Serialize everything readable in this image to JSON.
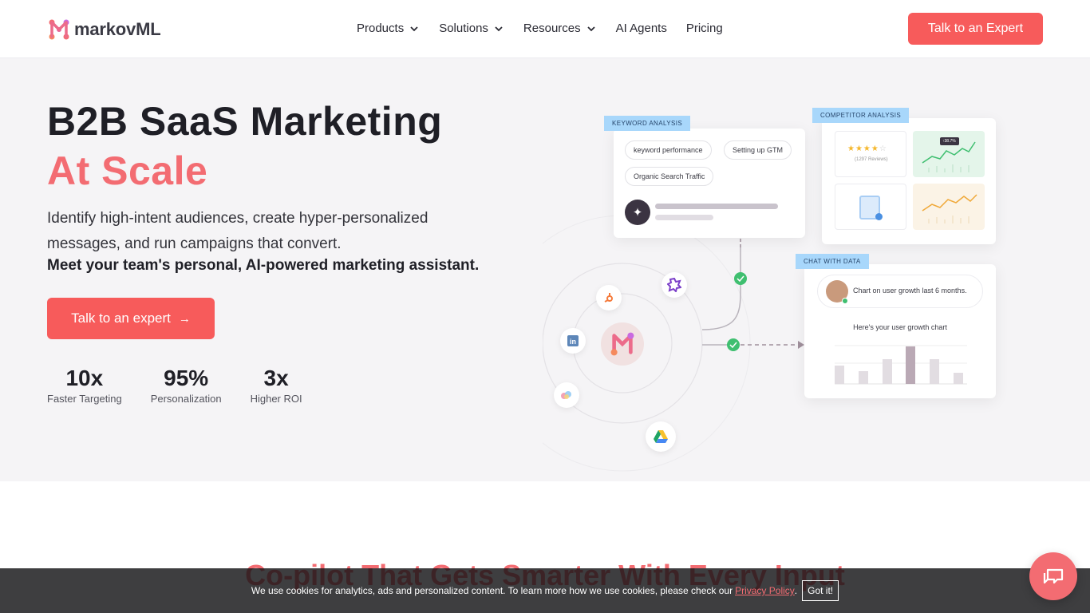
{
  "nav": {
    "logo_text": "markovML",
    "items": [
      {
        "label": "Products",
        "dropdown": true
      },
      {
        "label": "Solutions",
        "dropdown": true
      },
      {
        "label": "Resources",
        "dropdown": true
      },
      {
        "label": "AI Agents",
        "dropdown": false
      },
      {
        "label": "Pricing",
        "dropdown": false
      }
    ],
    "cta": "Talk to an Expert"
  },
  "hero": {
    "title_line1": "B2B SaaS Marketing",
    "title_line2": "At Scale",
    "subtitle": "Identify high-intent audiences, create hyper-personalized messages, and run campaigns that convert.",
    "subtitle_bold": "Meet your team's personal, AI-powered marketing assistant.",
    "cta": "Talk to an expert",
    "stats": [
      {
        "value": "10x",
        "label": "Faster Targeting"
      },
      {
        "value": "95%",
        "label": "Personalization"
      },
      {
        "value": "3x",
        "label": "Higher ROI"
      }
    ]
  },
  "illustration": {
    "keyword_tag": "KEYWORD ANALYSIS",
    "keyword_pills": [
      "keyword performance",
      "Setting up GTM",
      "Organic Search Traffic"
    ],
    "competitor_tag": "COMPETITOR ANALYSIS",
    "reviews_text": "(1297 Reviews)",
    "tooltip_text": "↑38.7%",
    "chat_tag": "CHAT WITH DATA",
    "chat_prompt": "Chart on user growth last 6 months.",
    "chat_reply": "Here's your user growth chart",
    "integrations": [
      "hubspot-icon",
      "linkedin-icon",
      "google-drive-icon",
      "puzzle-icon",
      "looker-icon"
    ]
  },
  "section2": {
    "title": "Co-pilot That Gets Smarter With Every Input"
  },
  "cookie": {
    "text": "We use cookies for analytics, ads and personalized content. To learn more how we use cookies, please check our",
    "link": "Privacy Policy",
    "period": ".",
    "button": "Got it!"
  },
  "colors": {
    "brand": "#f75b5b",
    "accent_text": "#f36c72",
    "tag_blue": "#a8d7fb"
  }
}
